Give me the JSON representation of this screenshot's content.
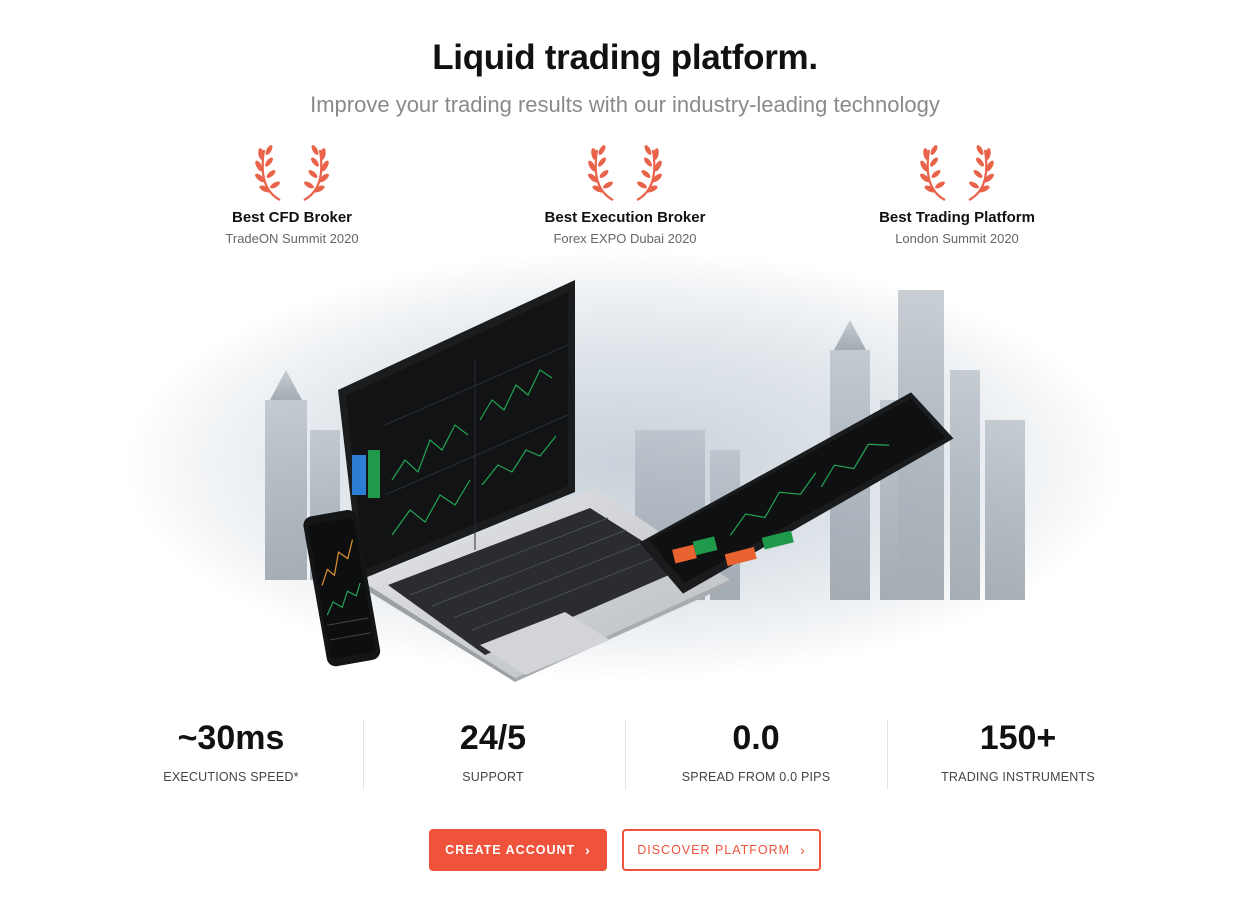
{
  "header": {
    "title": "Liquid trading platform.",
    "subtitle": "Improve your trading results with our industry-leading technology"
  },
  "awards": [
    {
      "title": "Best CFD Broker",
      "event": "TradeON Summit 2020",
      "icon": "laurel-icon"
    },
    {
      "title": "Best Execution Broker",
      "event": "Forex EXPO Dubai 2020",
      "icon": "laurel-icon"
    },
    {
      "title": "Best Trading Platform",
      "event": "London Summit 2020",
      "icon": "laurel-icon"
    }
  ],
  "stats": [
    {
      "value": "~30ms",
      "label": "EXECUTIONS SPEED*"
    },
    {
      "value": "24/5",
      "label": "SUPPORT"
    },
    {
      "value": "0.0",
      "label": "SPREAD FROM 0.0 PIPS"
    },
    {
      "value": "150+",
      "label": "TRADING INSTRUMENTS"
    }
  ],
  "buttons": {
    "primary": "CREATE ACCOUNT",
    "secondary": "DISCOVER PLATFORM",
    "chevron_icon": "chevron-right-icon"
  },
  "colors": {
    "accent": "#f0533c",
    "laurel": "#e8634a",
    "text": "#111111",
    "muted": "#8a8a8a"
  }
}
